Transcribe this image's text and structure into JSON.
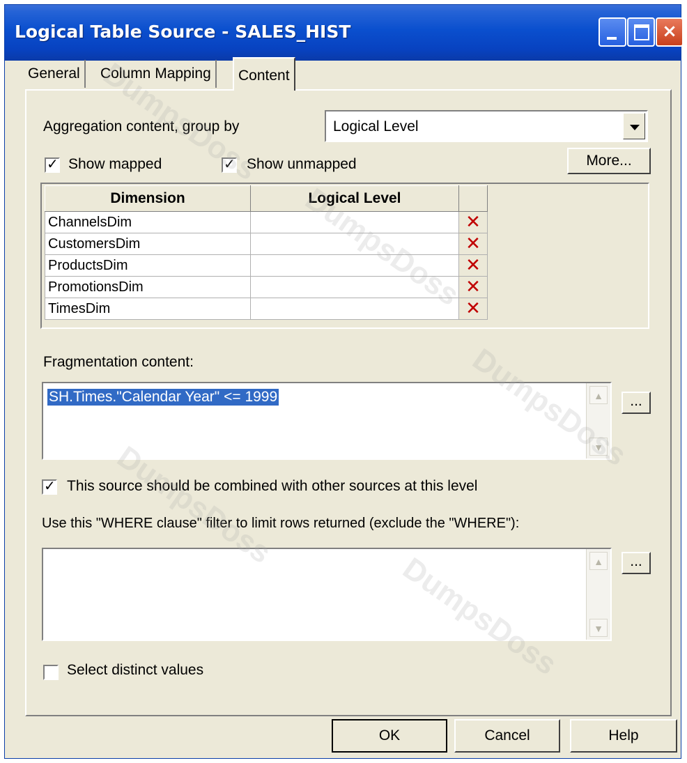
{
  "window": {
    "title": "Logical Table Source - SALES_HIST"
  },
  "tabs": [
    {
      "label": "General"
    },
    {
      "label": "Column Mapping"
    },
    {
      "label": "Content"
    }
  ],
  "aggregation": {
    "label": "Aggregation content, group by",
    "selected": "Logical Level"
  },
  "show_mapped": {
    "label": "Show mapped",
    "checked": true
  },
  "show_unmapped": {
    "label": "Show unmapped",
    "checked": true
  },
  "more_button": "More...",
  "grid": {
    "headers": [
      "Dimension",
      "Logical Level",
      ""
    ],
    "rows": [
      {
        "dimension": "ChannelsDim",
        "level": ""
      },
      {
        "dimension": "CustomersDim",
        "level": ""
      },
      {
        "dimension": "ProductsDim",
        "level": ""
      },
      {
        "dimension": "PromotionsDim",
        "level": ""
      },
      {
        "dimension": "TimesDim",
        "level": ""
      }
    ]
  },
  "fragmentation": {
    "label": "Fragmentation content:",
    "value": "SH.Times.\"Calendar Year\" <= 1999",
    "ellipsis": "..."
  },
  "combine": {
    "label": "This source should be combined with other sources at this level",
    "checked": true
  },
  "where": {
    "label": "Use this \"WHERE clause\" filter to limit rows returned (exclude the \"WHERE\"):",
    "value": "",
    "ellipsis": "..."
  },
  "distinct": {
    "label": "Select distinct values",
    "checked": false
  },
  "footer": {
    "ok": "OK",
    "cancel": "Cancel",
    "help": "Help"
  },
  "watermark_text": "DumpsDoss",
  "colors": {
    "titlebar": "#0a4fce",
    "face": "#ece9d8",
    "selection": "#316ac5",
    "delete_x": "#c00000"
  }
}
